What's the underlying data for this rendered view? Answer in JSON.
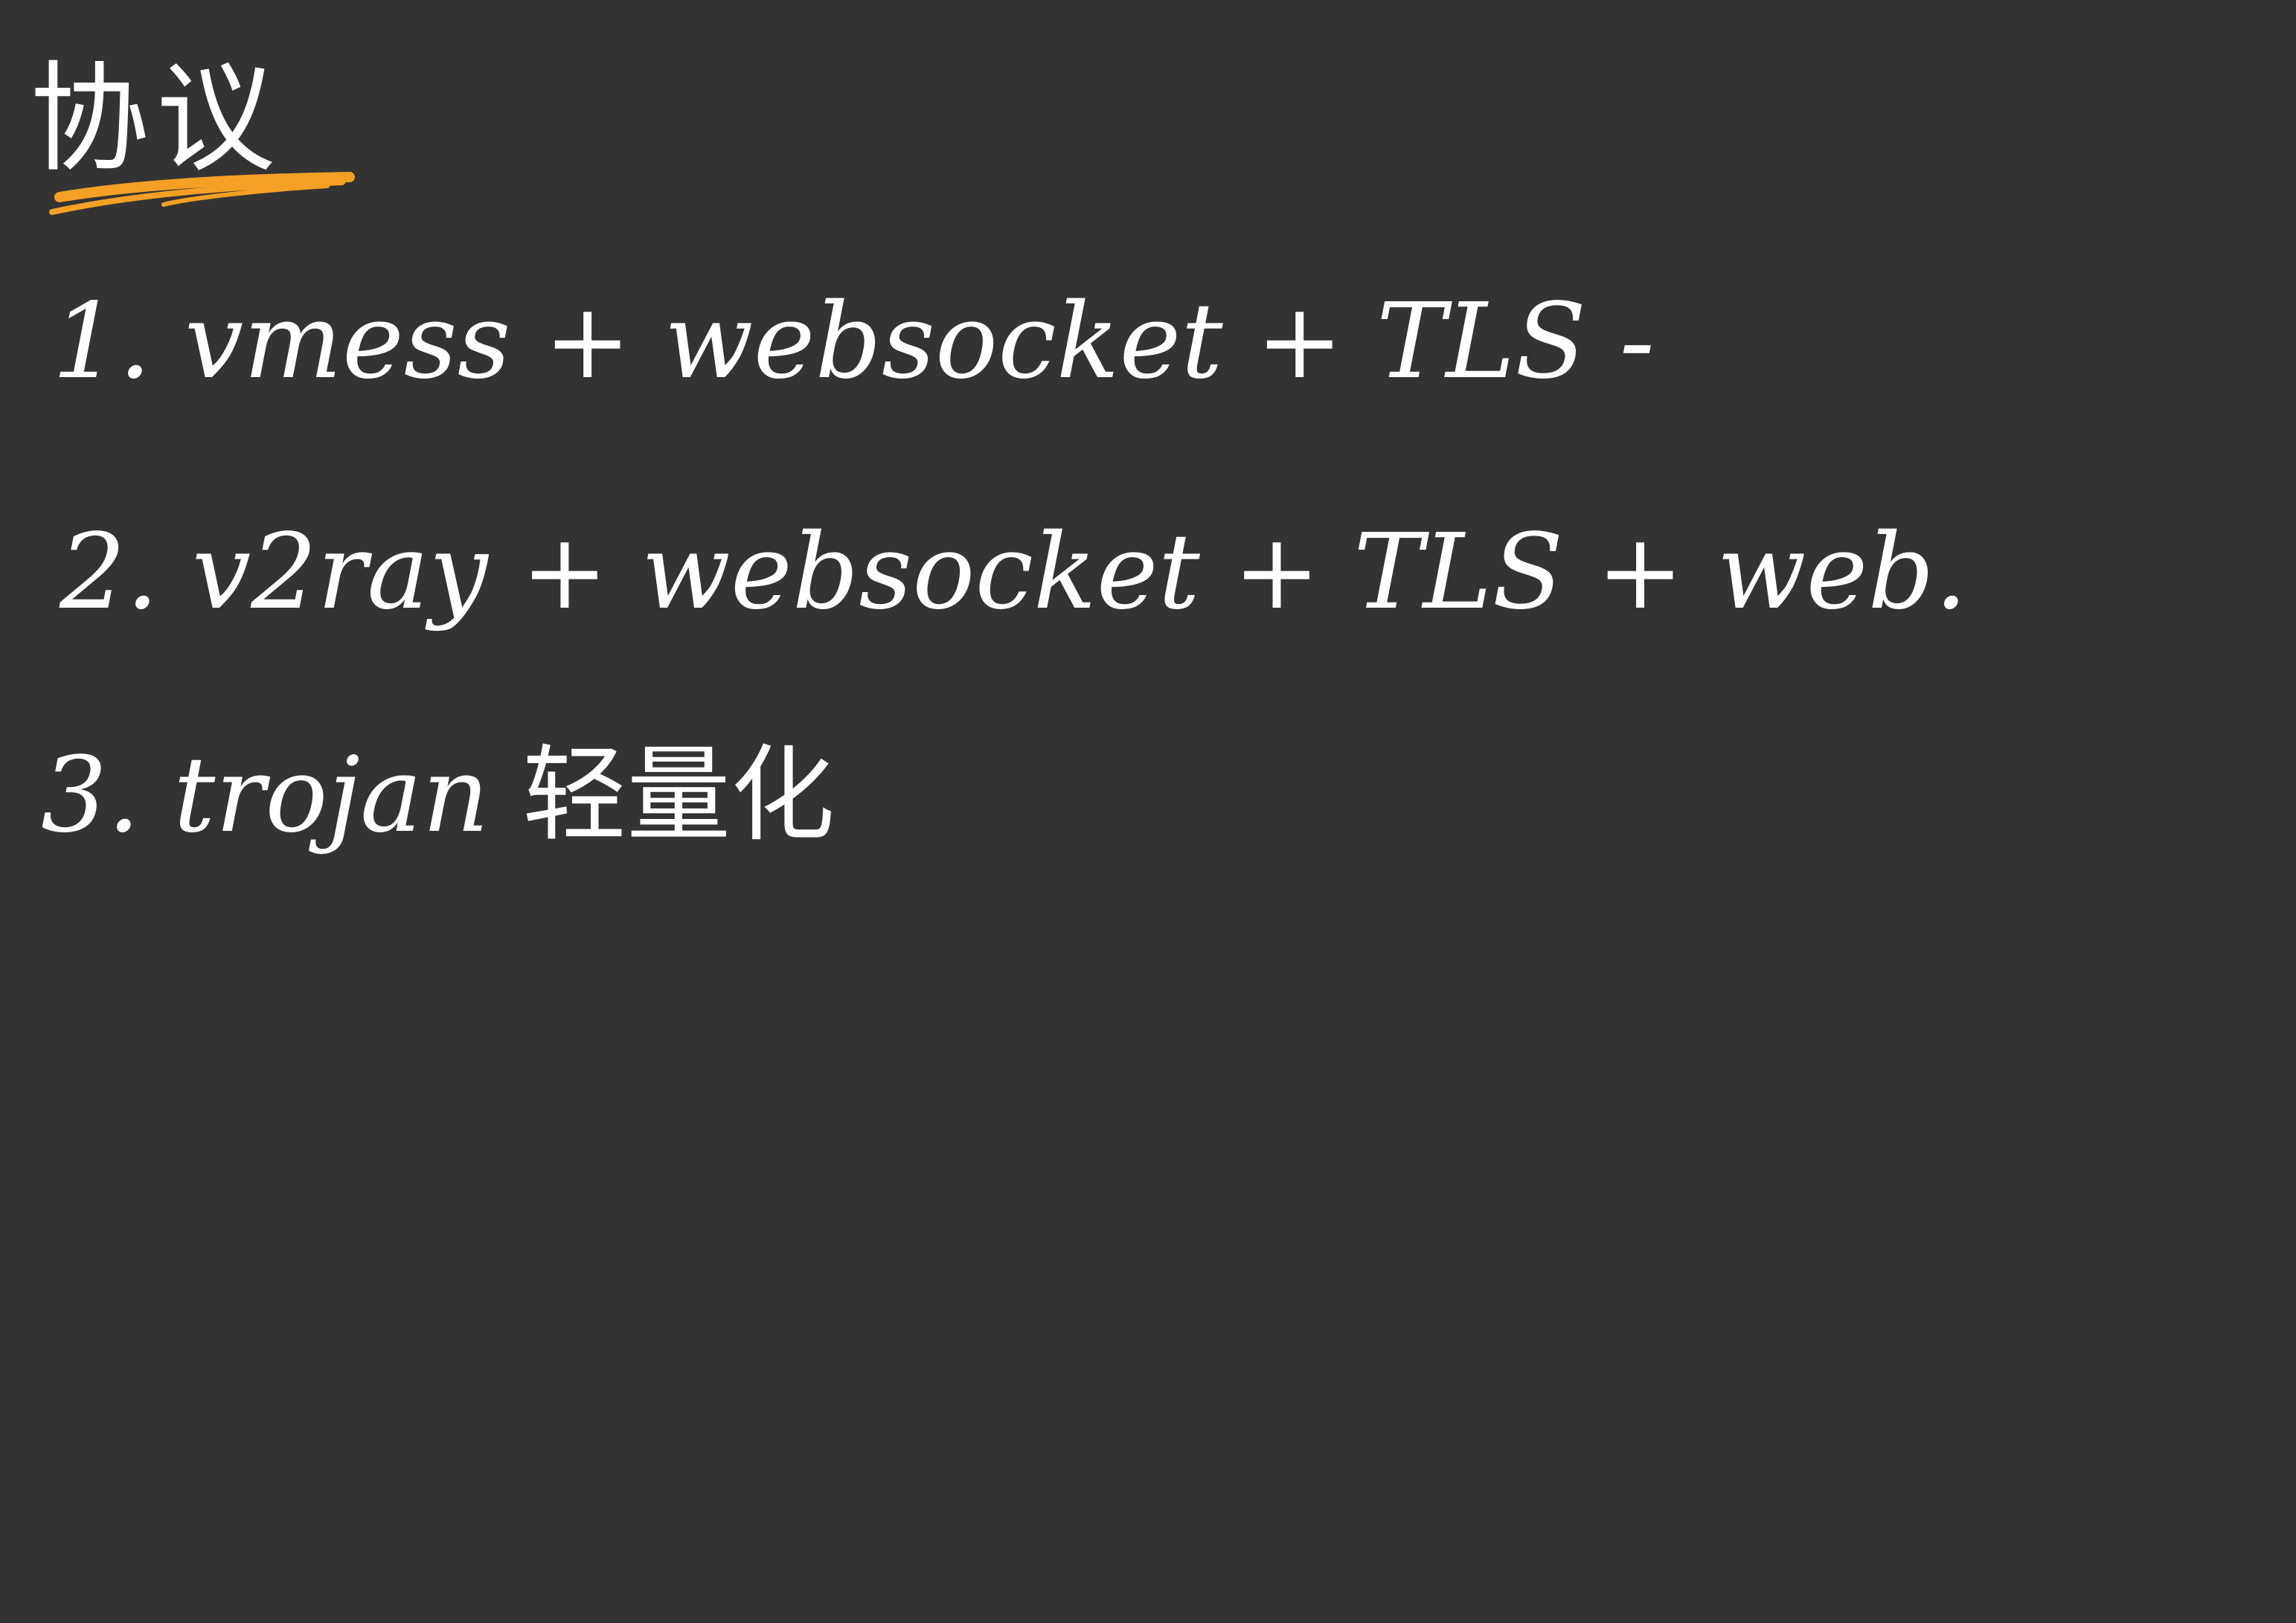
{
  "note": {
    "title": "协议",
    "highlight_color": "#F4A024",
    "ink_color": "#FFFFFF",
    "background_color": "#333333",
    "items": [
      {
        "number": "1.",
        "text": "vmess + websocket + TLS -"
      },
      {
        "number": "2.",
        "text": "v2ray + websocket + TLS + web."
      },
      {
        "number": "3.",
        "text": "trojan",
        "suffix": "轻量化"
      }
    ]
  }
}
